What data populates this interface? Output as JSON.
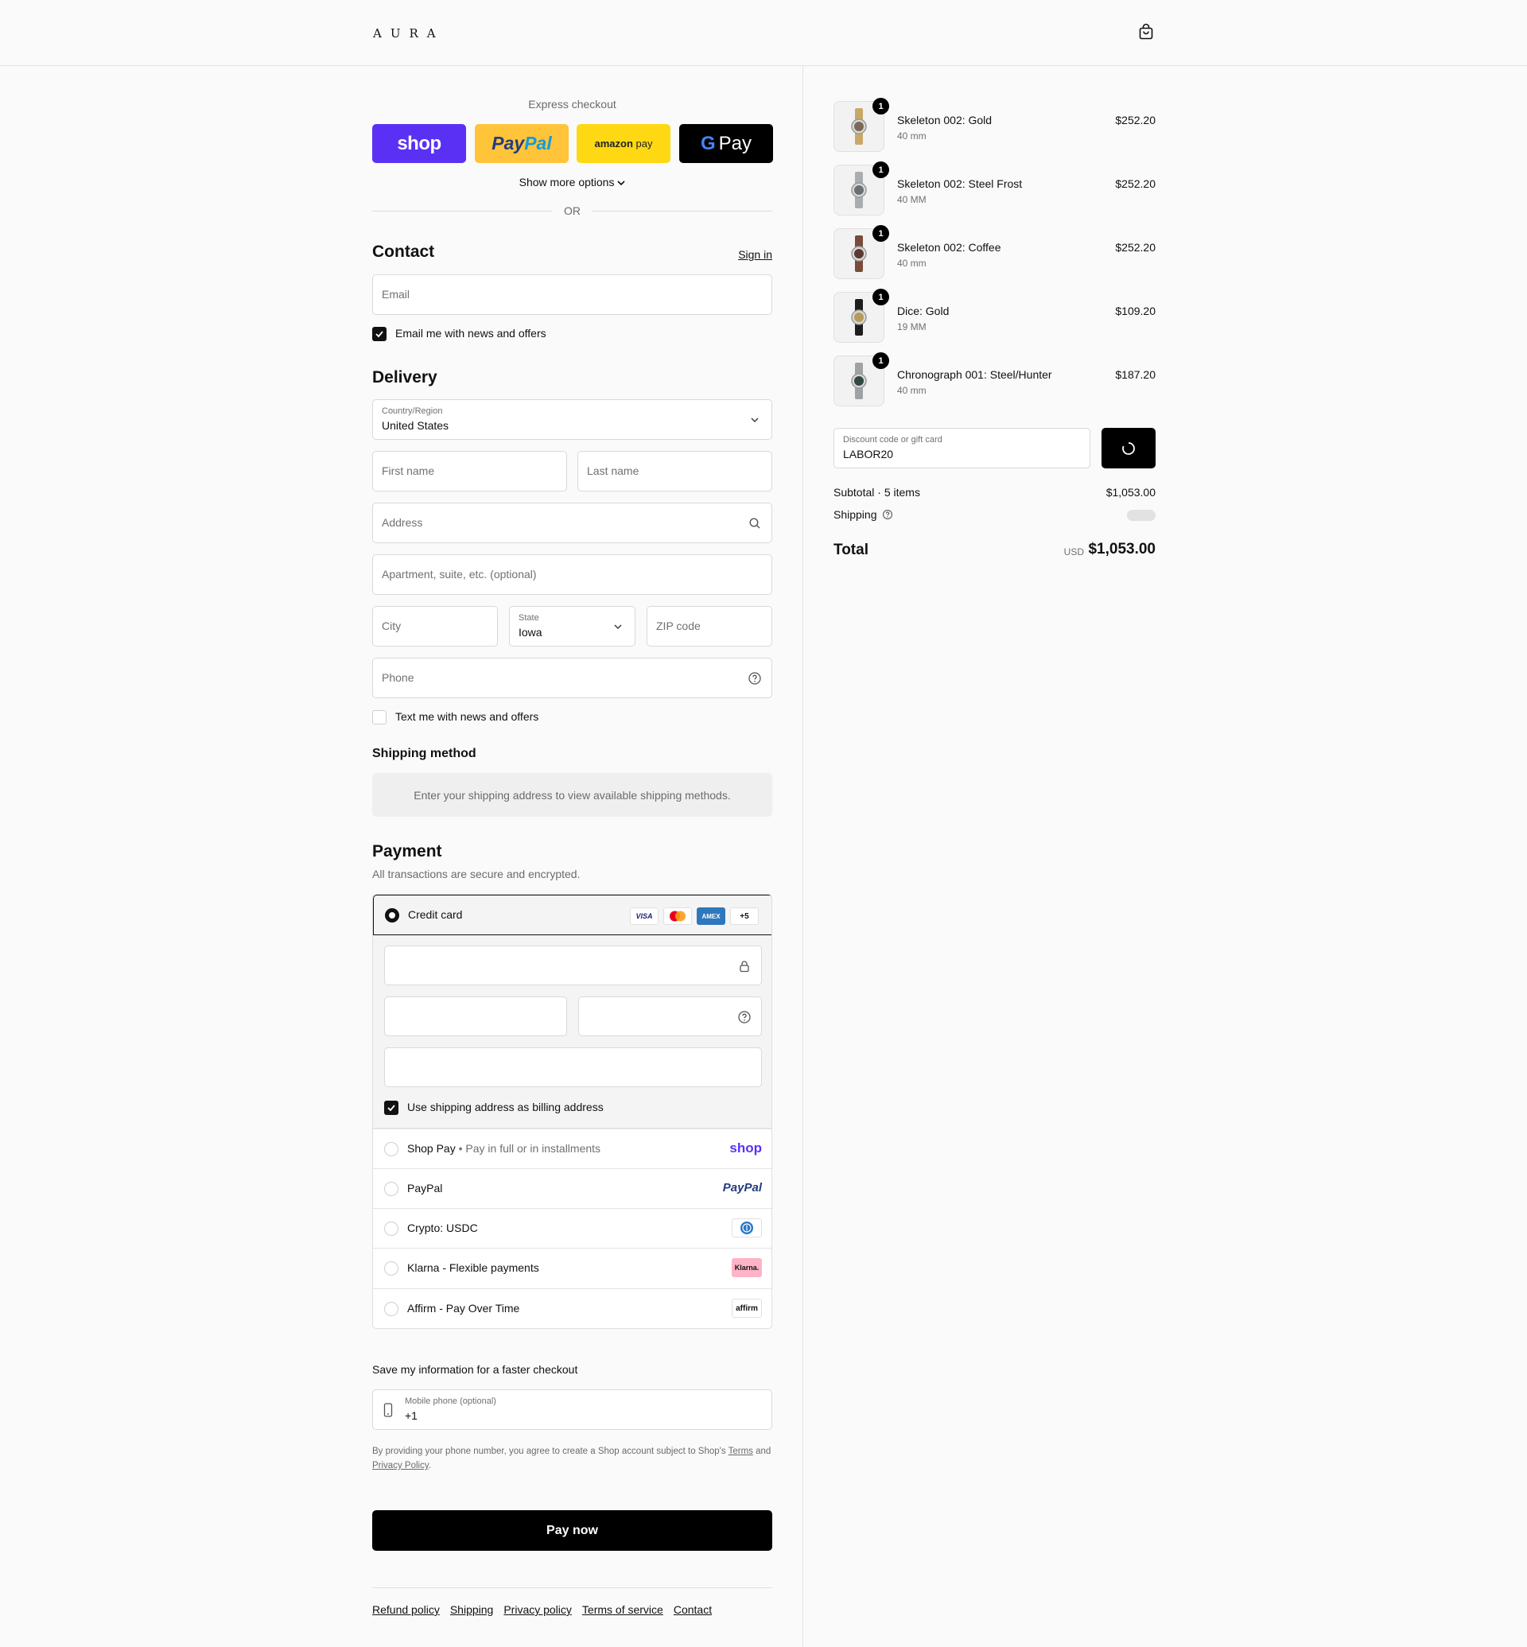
{
  "header": {
    "logo": "AURA",
    "bag_icon": "shopping-bag-icon"
  },
  "express": {
    "label": "Express checkout",
    "shop": "shop",
    "paypal_a": "Pay",
    "paypal_b": "Pal",
    "amazon_a": "amazon",
    "amazon_b": "pay",
    "gpay_g": "G",
    "gpay": "Pay",
    "more": "Show more options",
    "or": "OR"
  },
  "contact": {
    "title": "Contact",
    "sign_in": "Sign in",
    "email_placeholder": "Email",
    "news_label": "Email me with news and offers",
    "news_checked": true
  },
  "delivery": {
    "title": "Delivery",
    "country_label": "Country/Region",
    "country_value": "United States",
    "first_name": "First name",
    "last_name": "Last name",
    "address": "Address",
    "apartment": "Apartment, suite, etc. (optional)",
    "city": "City",
    "state_label": "State",
    "state_value": "Iowa",
    "zip": "ZIP code",
    "phone": "Phone",
    "text_label": "Text me with news and offers",
    "text_checked": false
  },
  "shipping_method": {
    "title": "Shipping method",
    "notice": "Enter your shipping address to view available shipping methods."
  },
  "payment": {
    "title": "Payment",
    "subtitle": "All transactions are secure and encrypted.",
    "credit_card": "Credit card",
    "cards": [
      "VISA",
      "",
      "AMEX",
      "+5"
    ],
    "billing_label": "Use shipping address as billing address",
    "methods": [
      {
        "name": "Shop Pay",
        "sub": "Pay in full or in installments",
        "logo": "shop"
      },
      {
        "name": "PayPal",
        "sub": "",
        "logo": "PayPal"
      },
      {
        "name": "Crypto: USDC",
        "sub": "",
        "logo": ""
      },
      {
        "name": "Klarna - Flexible payments",
        "sub": "",
        "logo": "Klarna."
      },
      {
        "name": "Affirm - Pay Over Time",
        "sub": "",
        "logo": "affirm"
      }
    ]
  },
  "save": {
    "title": "Save my information for a faster checkout",
    "phone_label": "Mobile phone (optional)",
    "phone_value": "+1",
    "legal_a": "By providing your phone number, you agree to create a Shop account subject to Shop's",
    "terms": "Terms",
    "legal_b": "and",
    "privacy": "Privacy Policy",
    "legal_c": "."
  },
  "pay_now": "Pay now",
  "footer_links": [
    "Refund policy",
    "Shipping",
    "Privacy policy",
    "Terms of service",
    "Contact"
  ],
  "cart": {
    "items": [
      {
        "qty": "1",
        "name": "Skeleton 002: Gold",
        "size": "40 mm",
        "price": "$252.20",
        "strap": "#c9a867",
        "face": "#7a6a55"
      },
      {
        "qty": "1",
        "name": "Skeleton 002: Steel Frost",
        "size": "40 MM",
        "price": "$252.20",
        "strap": "#a9acb0",
        "face": "#6c6f73"
      },
      {
        "qty": "1",
        "name": "Skeleton 002: Coffee",
        "size": "40 mm",
        "price": "$252.20",
        "strap": "#7a4a3a",
        "face": "#5a3a30"
      },
      {
        "qty": "1",
        "name": "Dice: Gold",
        "size": "19 MM",
        "price": "$109.20",
        "strap": "#1d1d1d",
        "face": "#b89a5a"
      },
      {
        "qty": "1",
        "name": "Chronograph 001: Steel/Hunter",
        "size": "40 mm",
        "price": "$187.20",
        "strap": "#9ea2a5",
        "face": "#2f4a40"
      }
    ],
    "discount_label": "Discount code or gift card",
    "discount_value": "LABOR20",
    "subtotal_label": "Subtotal · 5 items",
    "subtotal_value": "$1,053.00",
    "shipping_label": "Shipping",
    "total_label": "Total",
    "currency": "USD",
    "total_value": "$1,053.00"
  }
}
